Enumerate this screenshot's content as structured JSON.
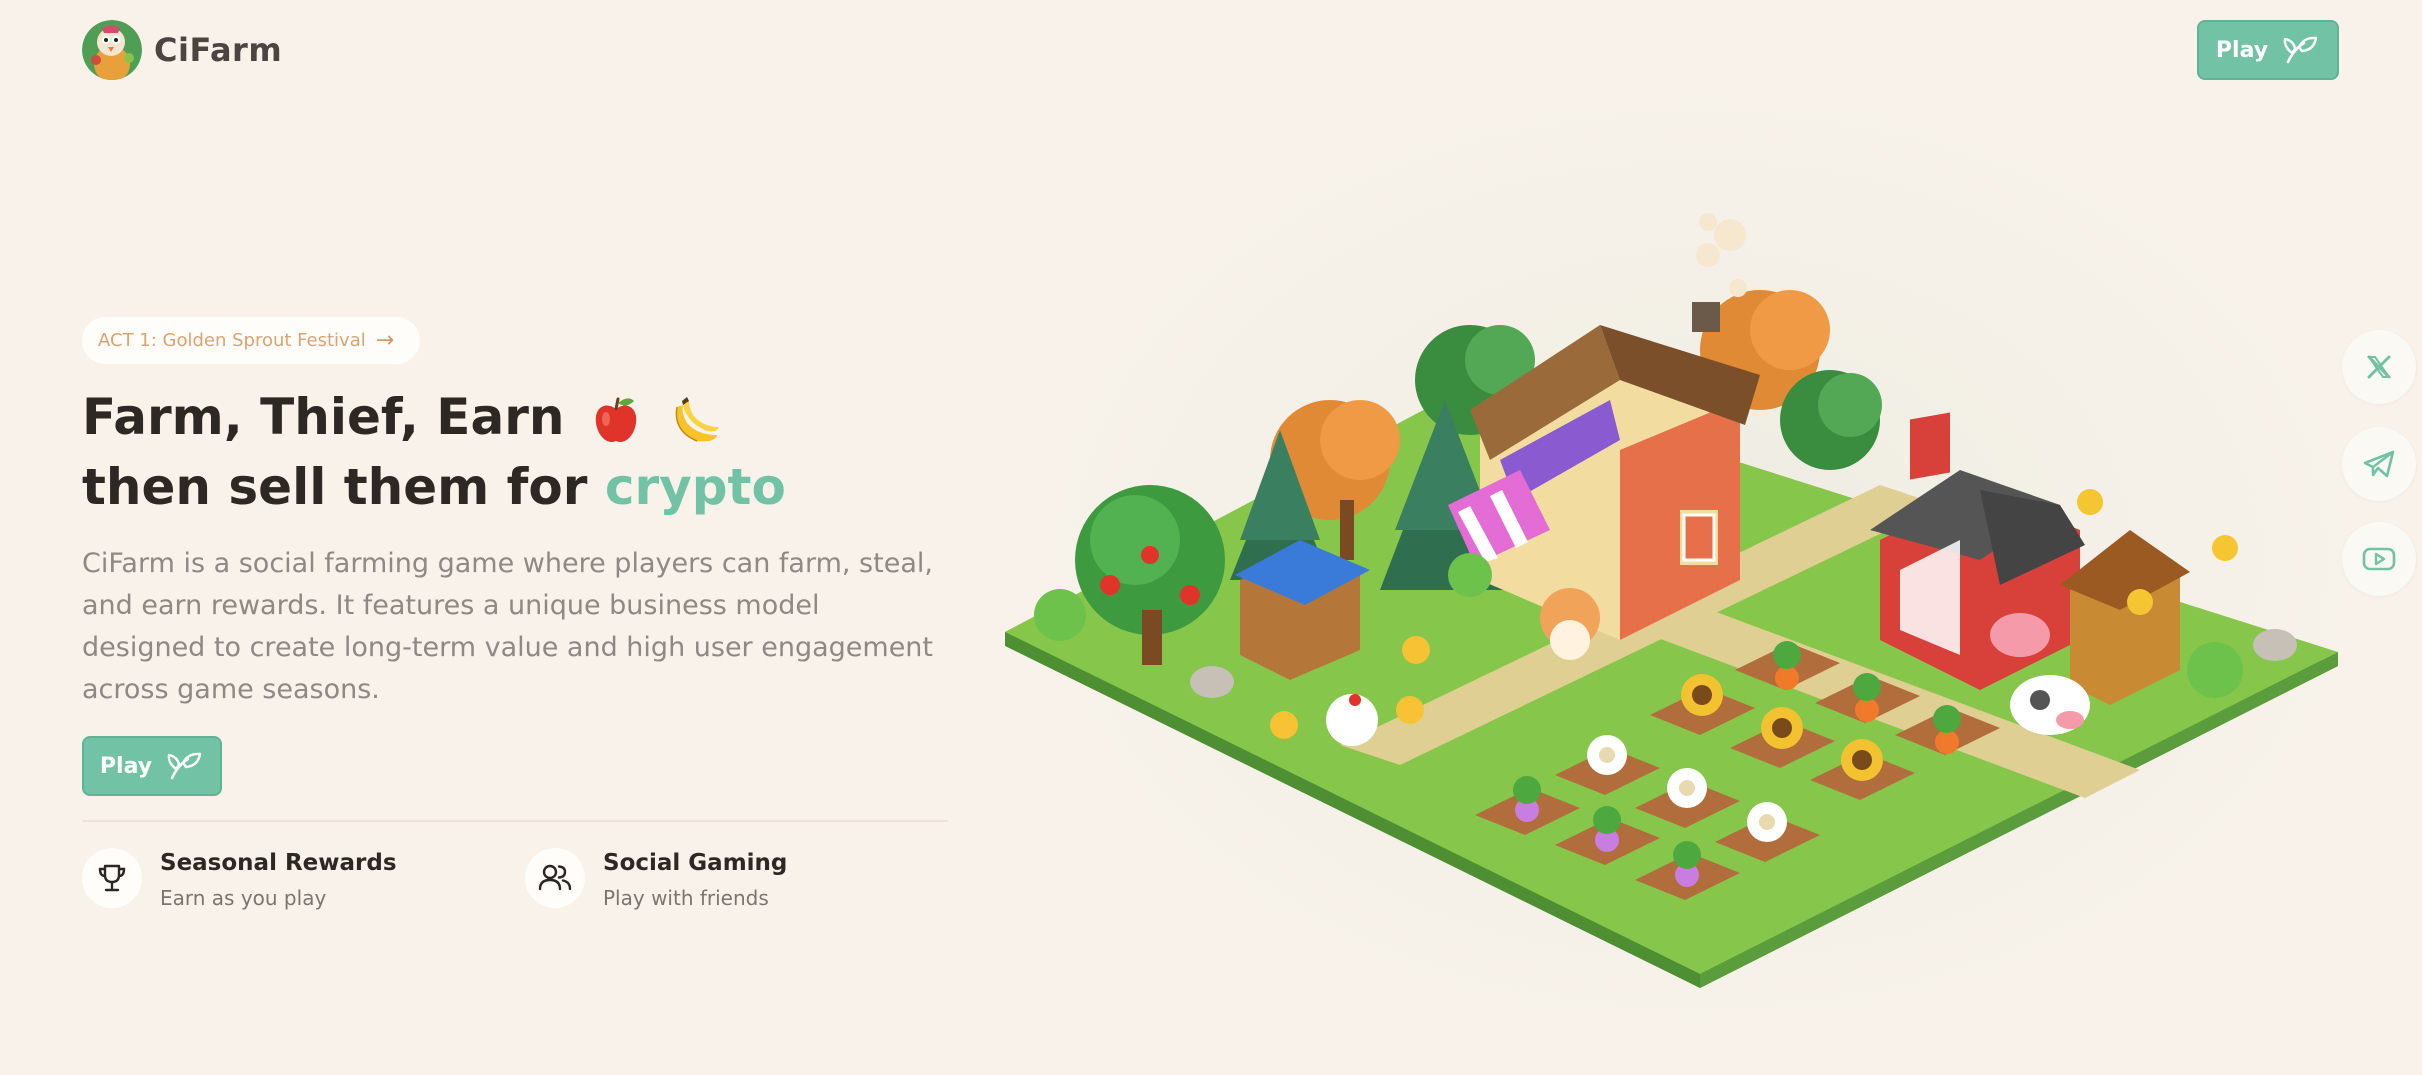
{
  "header": {
    "brand": "CiFarm",
    "play_label": "Play"
  },
  "badge": {
    "text": "ACT 1: Golden Sprout Festival",
    "arrow": "→"
  },
  "hero": {
    "line1": "Farm, Thief, Earn",
    "line2_prefix": "then sell them for",
    "line2_accent": "crypto",
    "description": "CiFarm is a social farming game where players can farm, steal, and earn rewards. It features a unique business model designed to create long-term value and high user engagement across game seasons.",
    "play_label": "Play"
  },
  "features": [
    {
      "title": "Seasonal Rewards",
      "subtitle": "Earn as you play",
      "icon": "trophy-icon"
    },
    {
      "title": "Social Gaming",
      "subtitle": "Play with friends",
      "icon": "users-icon"
    }
  ],
  "social": [
    "x-icon",
    "telegram-icon",
    "youtube-icon"
  ],
  "colors": {
    "accent": "#72c2a6",
    "background": "#f8f2ea",
    "badge_text": "#d9a374"
  }
}
